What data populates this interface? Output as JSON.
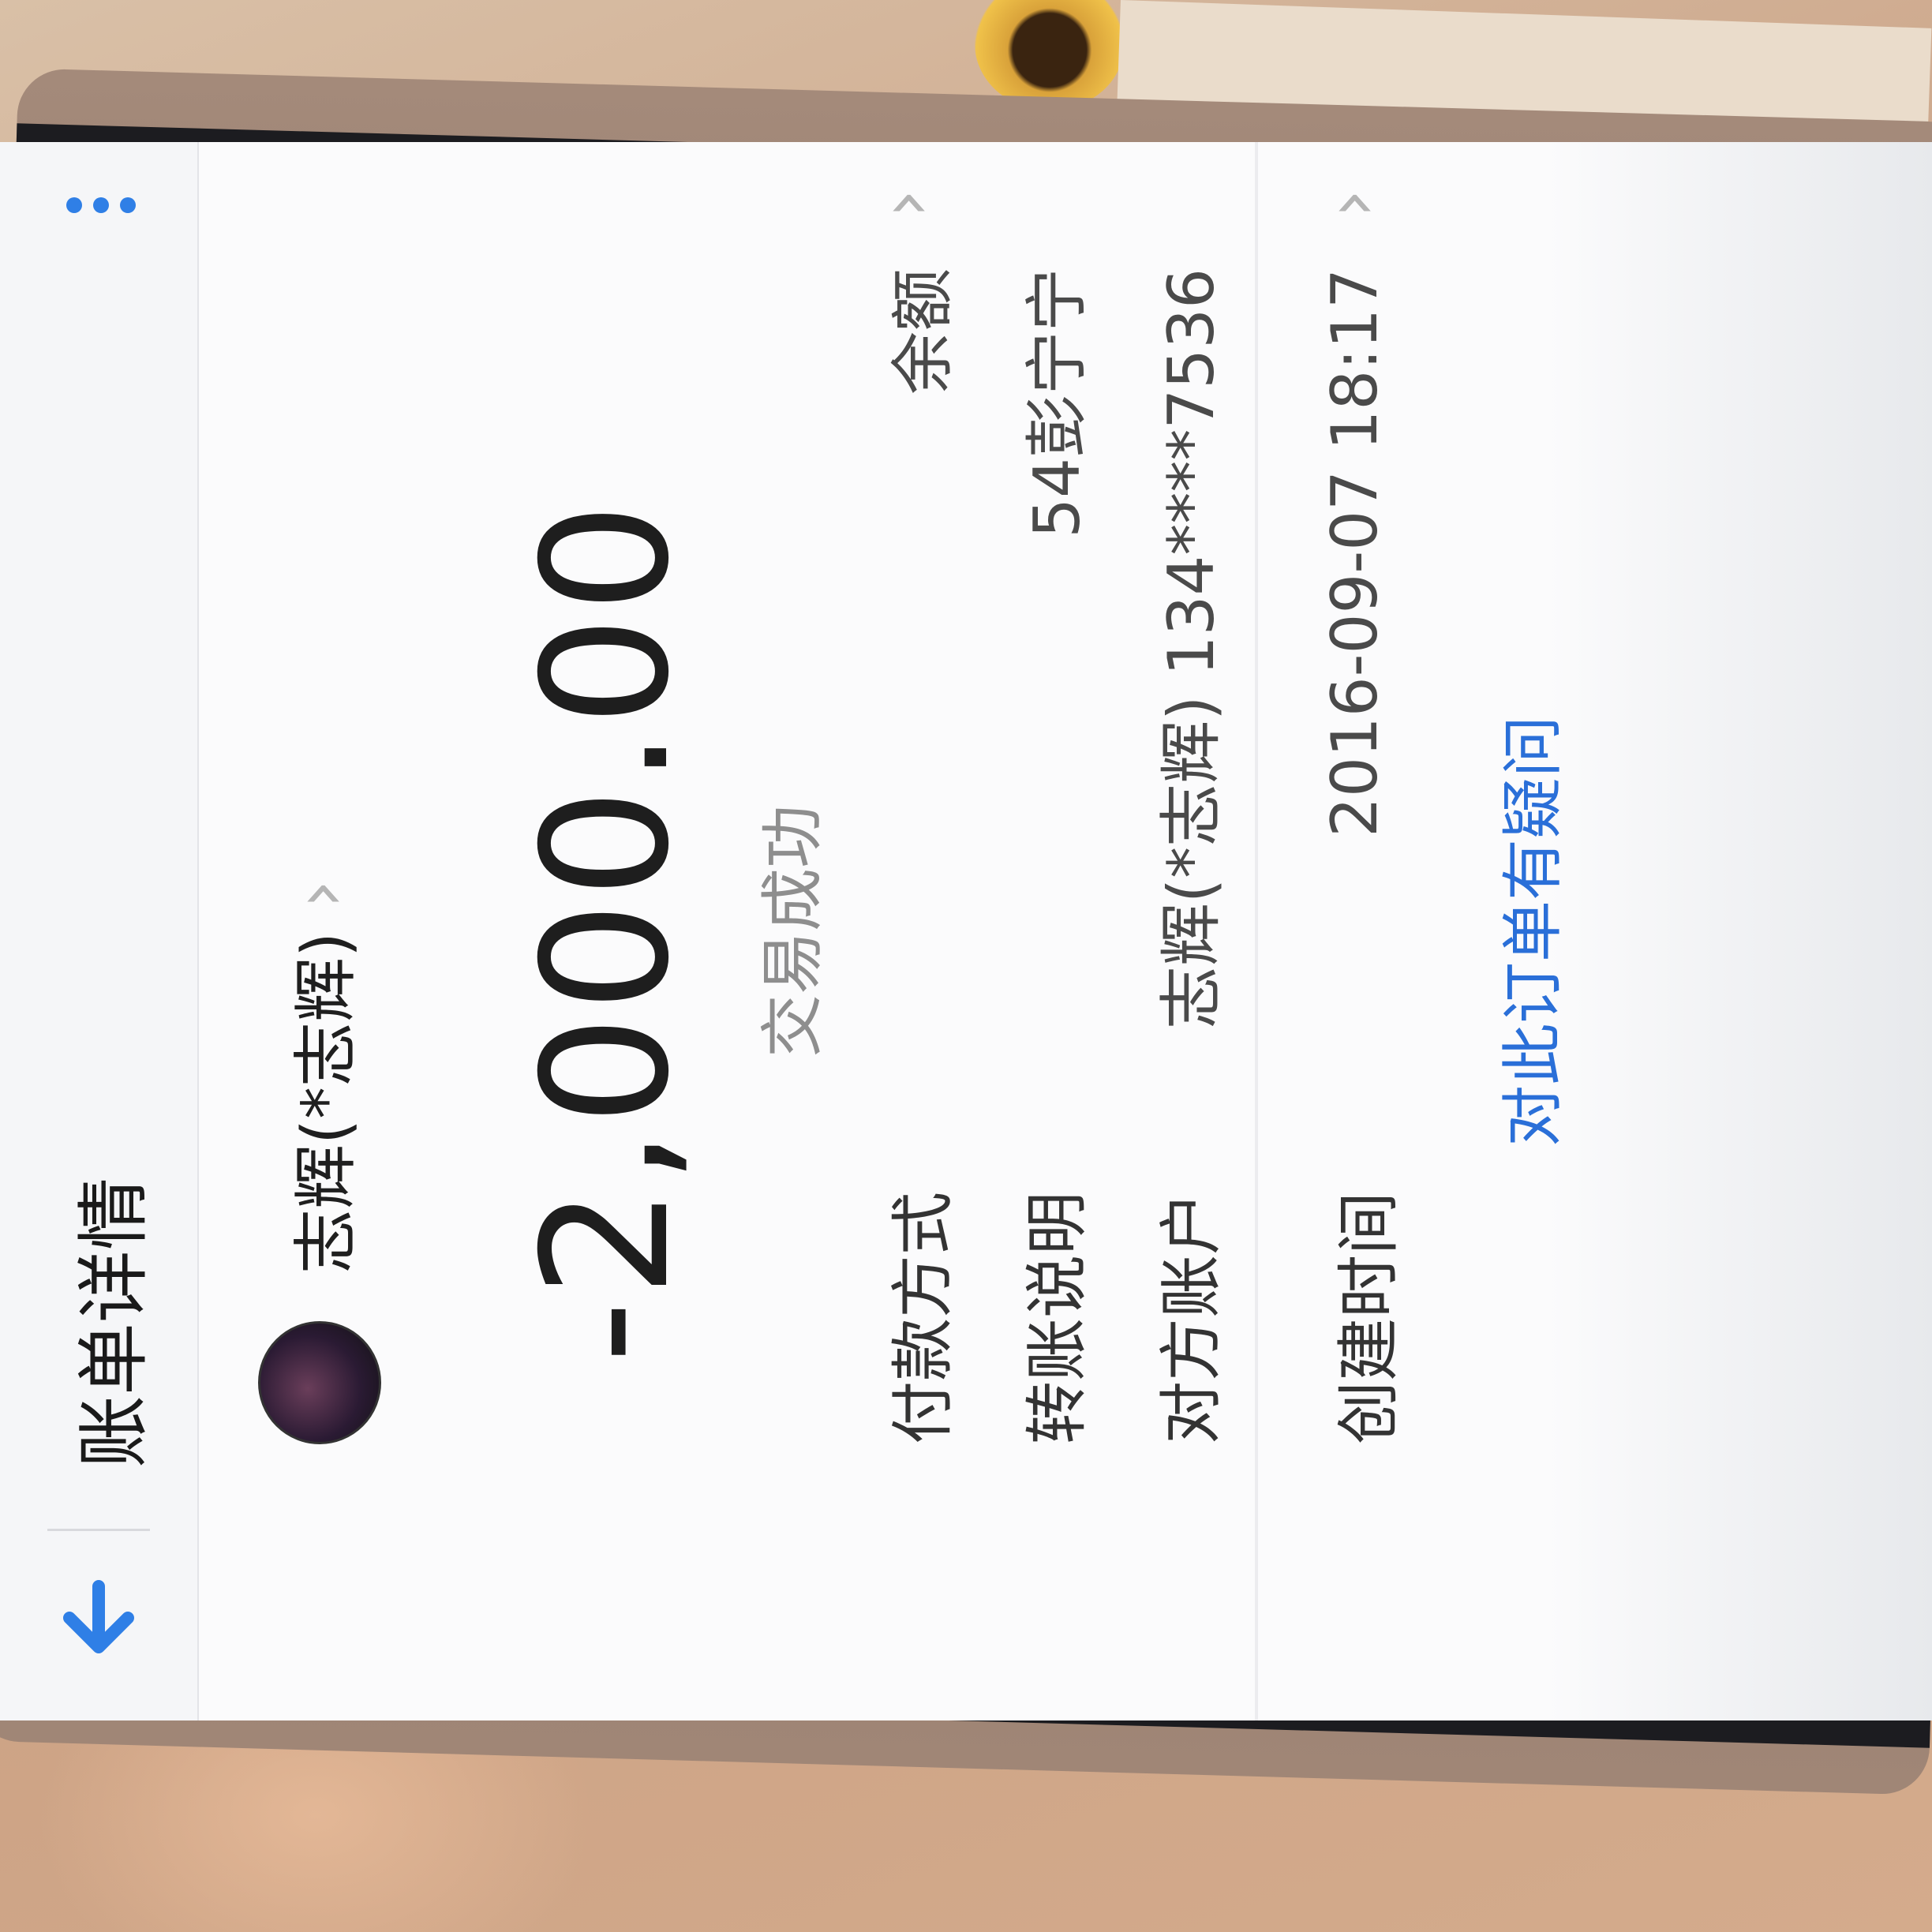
{
  "navbar": {
    "title": "账单详情"
  },
  "payee": {
    "name": "志辉(*志辉)"
  },
  "transaction": {
    "amount": "-2,000.00",
    "status": "交易成功"
  },
  "details": [
    {
      "label": "付款方式",
      "value": "余额",
      "has_chevron": true
    },
    {
      "label": "转账说明",
      "value": "54彭宁宁",
      "has_chevron": false
    },
    {
      "label": "对方账户",
      "value": "志辉(*志辉) 134****7536",
      "has_chevron": false
    },
    {
      "label": "创建时间",
      "value": "2016-09-07 18:17",
      "has_chevron": true
    }
  ],
  "footer": {
    "link": "对此订单有疑问"
  },
  "icons": {
    "back": "back-arrow-icon",
    "more": "more-vertical-icon",
    "chevron": "chevron-right-icon"
  },
  "colors": {
    "accent": "#2f7fe6",
    "link": "#2a6fd8"
  }
}
